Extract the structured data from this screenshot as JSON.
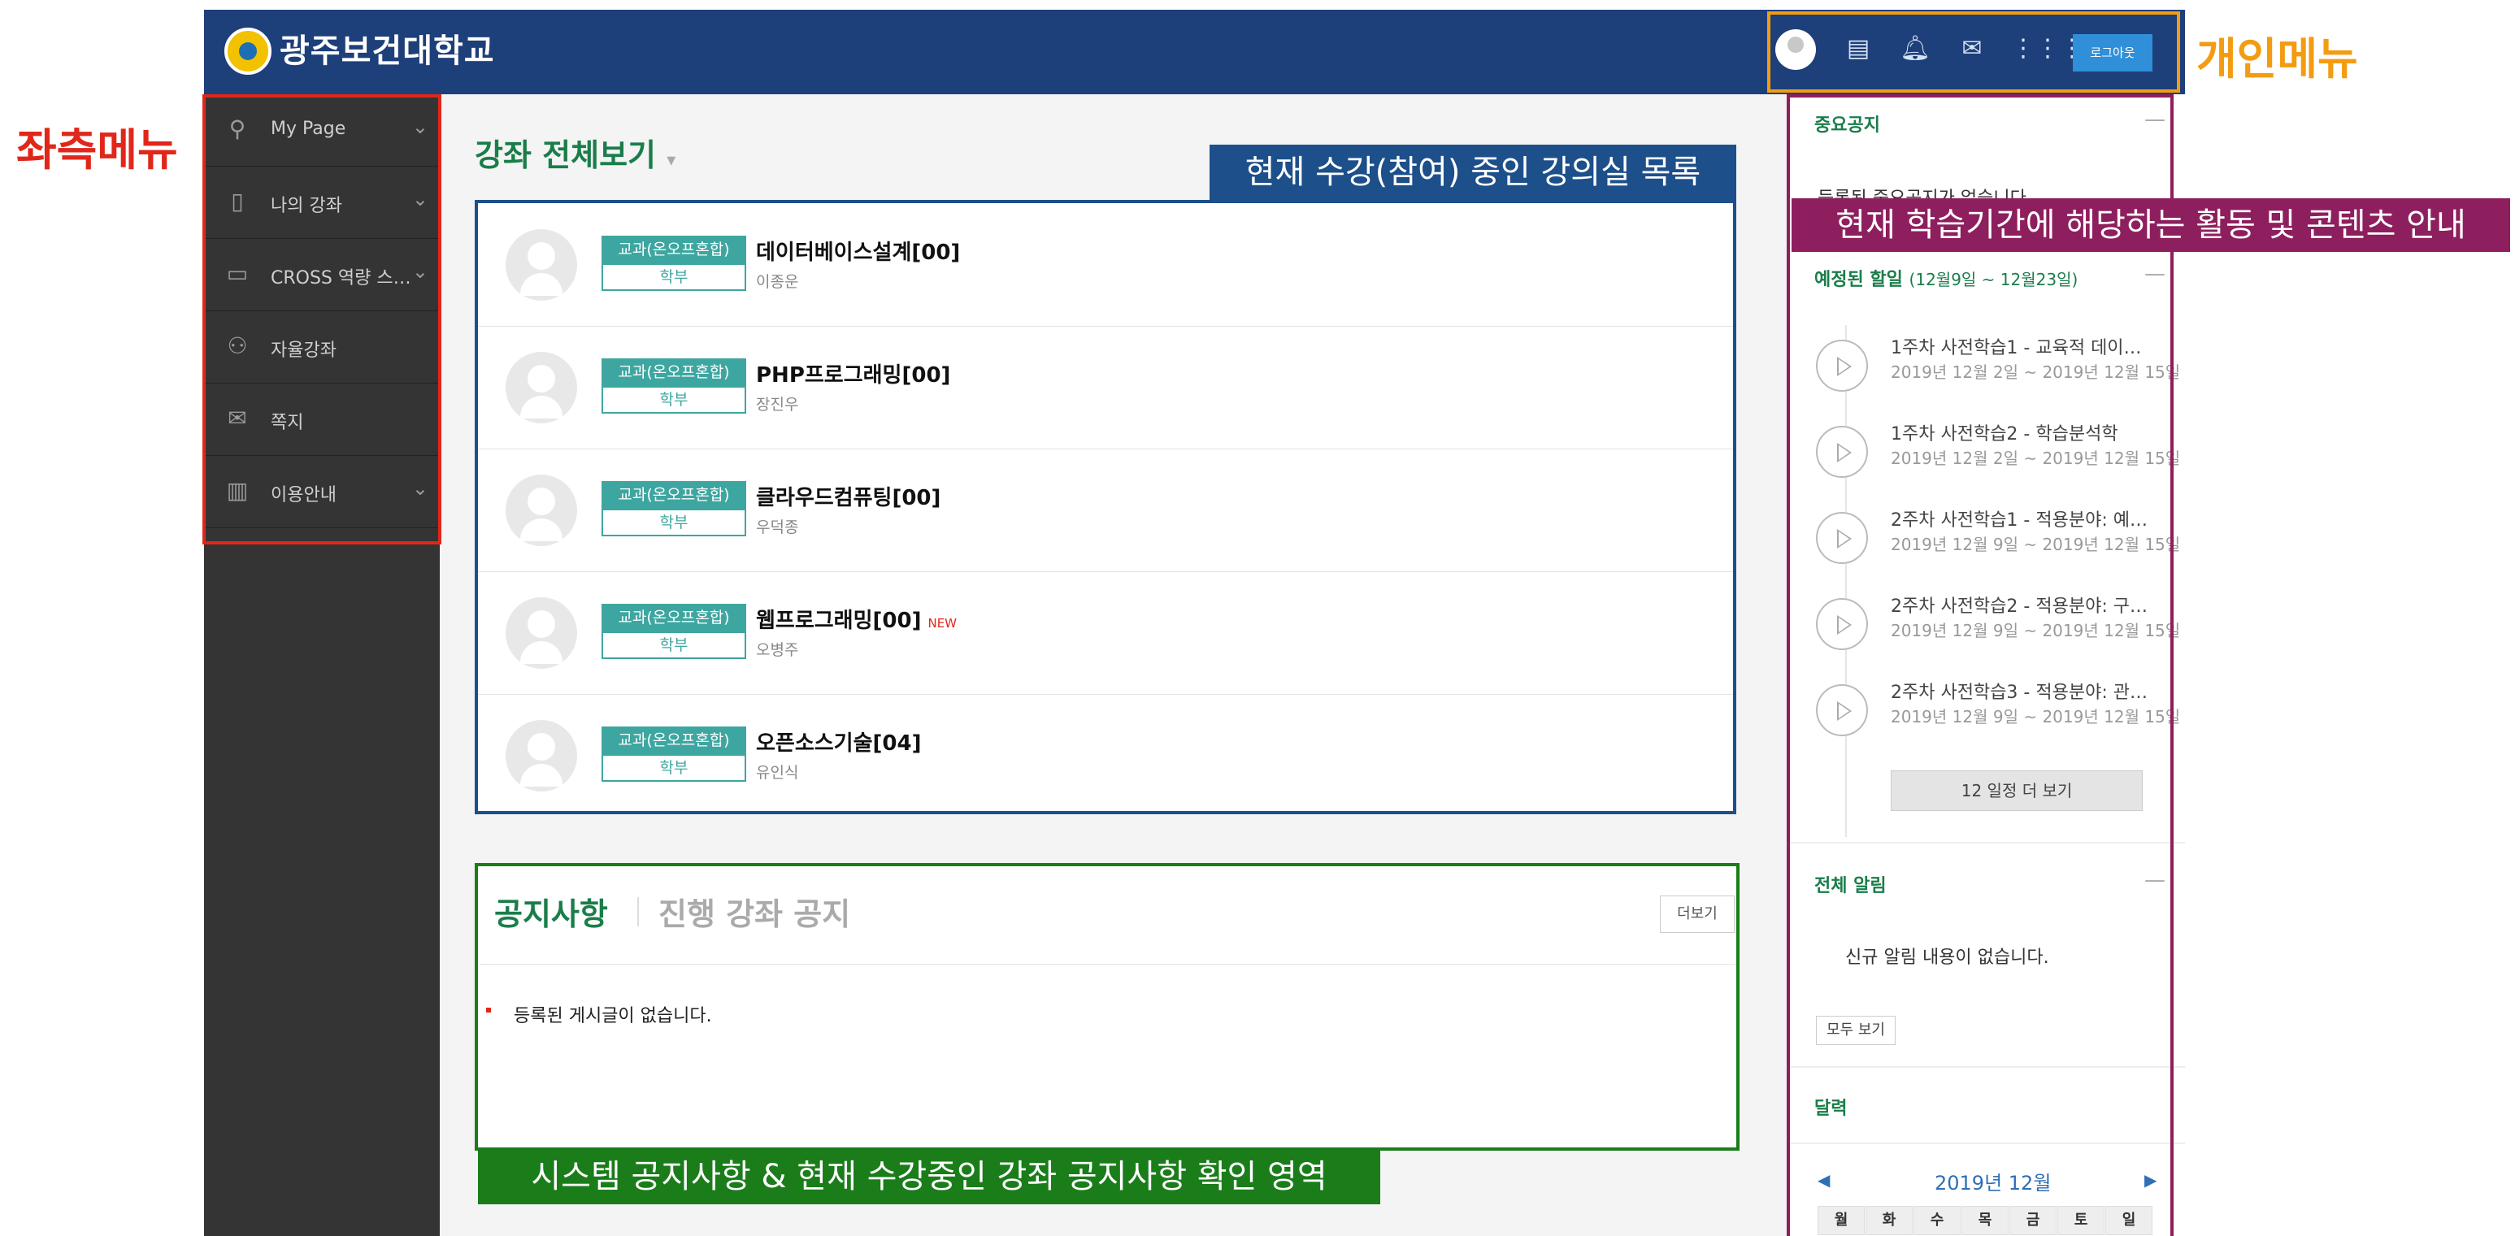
{
  "header": {
    "logo_text": "광주보건대학교",
    "logout_label": "로그아웃",
    "icons": [
      "user-avatar",
      "panel-icon",
      "bell-icon",
      "mail-icon",
      "grid-icon"
    ]
  },
  "annotations": {
    "personal_menu": "개인메뉴",
    "left_menu": "좌측메뉴",
    "course_list": "현재 수강(참여) 중인 강의실 목록",
    "notice_area": "시스템 공지사항 & 현재 수강중인 강좌 공지사항 확인 영역",
    "right_panel": "현재 학습기간에 해당하는 활동 및 콘텐츠 안내"
  },
  "sidebar": {
    "items": [
      {
        "label": "My Page",
        "icon": "user-edit-icon",
        "has_chevron": true
      },
      {
        "label": "나의 강좌",
        "icon": "book-icon",
        "has_chevron": true
      },
      {
        "label": "CROSS 역량 스…",
        "icon": "presentation-icon",
        "has_chevron": true
      },
      {
        "label": "자율강좌",
        "icon": "people-icon",
        "has_chevron": false
      },
      {
        "label": "쪽지",
        "icon": "envelope-icon",
        "has_chevron": false
      },
      {
        "label": "이용안내",
        "icon": "map-icon",
        "has_chevron": true
      }
    ]
  },
  "courses": {
    "heading": "강좌 전체보기",
    "items": [
      {
        "badge": "교과(온오프혼합)",
        "level": "학부",
        "name": "데이터베이스설계[00]",
        "professor": "이종운",
        "new": ""
      },
      {
        "badge": "교과(온오프혼합)",
        "level": "학부",
        "name": "PHP프로그래밍[00]",
        "professor": "장진우",
        "new": ""
      },
      {
        "badge": "교과(온오프혼합)",
        "level": "학부",
        "name": "클라우드컴퓨팅[00]",
        "professor": "우덕종",
        "new": ""
      },
      {
        "badge": "교과(온오프혼합)",
        "level": "학부",
        "name": "웹프로그래밍[00]",
        "professor": "오병주",
        "new": "NEW"
      },
      {
        "badge": "교과(온오프혼합)",
        "level": "학부",
        "name": "오픈소스기술[04]",
        "professor": "유인식",
        "new": ""
      }
    ]
  },
  "notices": {
    "tab_active": "공지사항",
    "tab_inactive": "진행 강좌 공지",
    "more_label": "더보기",
    "empty_text": "등록된 게시글이 없습니다."
  },
  "right_panel": {
    "important_title": "중요공지",
    "important_empty": "등록된 중요공지가 없습니다.",
    "todo_title": "예정된 할일",
    "todo_range": "(12월9일 ~ 12월23일)",
    "todos": [
      {
        "title": "1주차 사전학습1 - 교육적 데이…",
        "date": "2019년 12월 2일 ~ 2019년 12월 15일"
      },
      {
        "title": "1주차 사전학습2 - 학습분석학",
        "date": "2019년 12월 2일 ~ 2019년 12월 15일"
      },
      {
        "title": "2주차 사전학습1 - 적용분야: 예…",
        "date": "2019년 12월 9일 ~ 2019년 12월 15일"
      },
      {
        "title": "2주차 사전학습2 - 적용분야: 구…",
        "date": "2019년 12월 9일 ~ 2019년 12월 15일"
      },
      {
        "title": "2주차 사전학습3 - 적용분야: 관…",
        "date": "2019년 12월 9일 ~ 2019년 12월 15일"
      }
    ],
    "more_schedule_label": "12 일정 더 보기",
    "alerts_title": "전체 알림",
    "alerts_empty": "신규 알림 내용이 없습니다.",
    "see_all_label": "모두 보기",
    "calendar_title": "달력",
    "calendar_month": "2019년 12월",
    "weekdays": [
      "월",
      "화",
      "수",
      "목",
      "금",
      "토",
      "일"
    ]
  },
  "colors": {
    "header_bg": "#1d3f7a",
    "sidebar_bg": "#343434",
    "accent_green": "#1a7d4a",
    "badge_teal": "#3ea6a0",
    "anno_red": "#e0271a",
    "anno_orange": "#f39c12",
    "anno_blue": "#1d4f8a",
    "anno_green": "#1a7d1a",
    "anno_purple": "#8e1f5e"
  }
}
